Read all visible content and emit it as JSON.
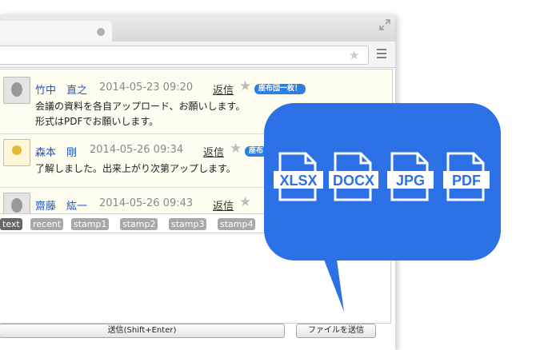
{
  "window": {
    "tab_title": ""
  },
  "messages": [
    {
      "name": "竹中　直之",
      "date": "2014-05-23 09:20",
      "reply": "返信",
      "badge": "座布団一枚！",
      "lines": [
        "会議の資料を各自アップロード、お願いします。",
        "形式はPDFでお願いします。"
      ]
    },
    {
      "name": "森本　剛",
      "date": "2014-05-26 09:34",
      "reply": "返信",
      "badge": "座布",
      "lines": [
        "了解しました。出来上がり次第アップします。"
      ]
    },
    {
      "name": "齋藤　紘一",
      "date": "2014-05-26 09:43",
      "reply": "返信"
    }
  ],
  "stamp_tabs": [
    "text",
    "recent",
    "stamp1",
    "stamp2",
    "stamp3",
    "stamp4"
  ],
  "buttons": {
    "send": "送信(Shift+Enter)",
    "send_file": "ファイルを送信"
  },
  "file_types": [
    "XLSX",
    "DOCX",
    "JPG",
    "PDF"
  ],
  "colors": {
    "bubble": "#2d71e6",
    "name": "#2255cc",
    "badge": "#2d7fe0"
  },
  "icons": {
    "favorite": "star-icon",
    "menu": "hamburger-icon",
    "expand": "expand-icon",
    "file": "document-icon"
  }
}
